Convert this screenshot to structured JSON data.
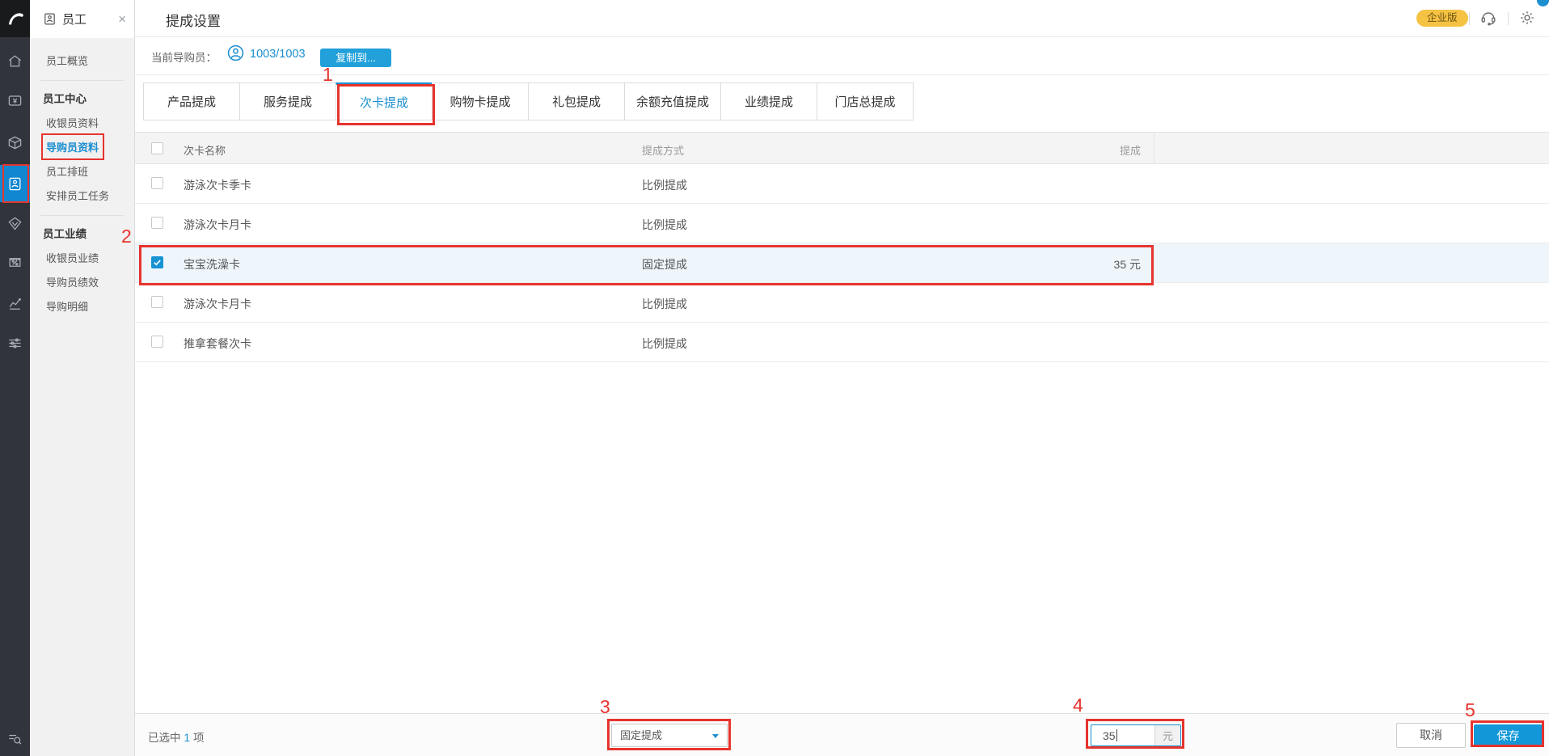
{
  "chrome": {
    "badge": "企业版",
    "close_label": "×",
    "icons": [
      "headset-icon",
      "gear-icon"
    ]
  },
  "rail": {
    "icons": [
      "home",
      "cashier",
      "orders",
      "staff",
      "membership",
      "marketing",
      "statistics",
      "settings-sliders"
    ],
    "active_icon": "staff",
    "bottom_icon": "search-menu"
  },
  "sidebar": {
    "title": "员工",
    "overview": "员工概览",
    "sections": [
      {
        "header": "员工中心",
        "items": [
          "收银员资料",
          "导购员资料",
          "员工排班",
          "安排员工任务"
        ]
      },
      {
        "header": "员工业绩",
        "items": [
          "收银员业绩",
          "导购员绩效",
          "导购明细"
        ]
      }
    ],
    "active_item": "导购员资料"
  },
  "page": {
    "title": "提成设置"
  },
  "toolbar": {
    "label": "当前导购员：",
    "guide_count": "1003/1003",
    "copy_button": "复制到..."
  },
  "tabs": [
    "产品提成",
    "服务提成",
    "次卡提成",
    "购物卡提成",
    "礼包提成",
    "余额充值提成",
    "业绩提成",
    "门店总提成"
  ],
  "active_tab": "次卡提成",
  "table": {
    "columns": {
      "name": "次卡名称",
      "method": "提成方式",
      "commission": "提成"
    },
    "rows": [
      {
        "name": "游泳次卡季卡",
        "method": "比例提成",
        "commission": "",
        "checked": false
      },
      {
        "name": "游泳次卡月卡",
        "method": "比例提成",
        "commission": "",
        "checked": false
      },
      {
        "name": "宝宝洗澡卡",
        "method": "固定提成",
        "commission": "35 元",
        "checked": true
      },
      {
        "name": "游泳次卡月卡",
        "method": "比例提成",
        "commission": "",
        "checked": false
      },
      {
        "name": "推拿套餐次卡",
        "method": "比例提成",
        "commission": "",
        "checked": false
      }
    ]
  },
  "footer": {
    "selected_prefix": "已选中",
    "selected_count": "1",
    "selected_suffix": "项",
    "method_select": "固定提成",
    "amount_value": "35",
    "amount_unit": "元",
    "cancel_button": "取消",
    "save_button": "保存"
  },
  "annotations": {
    "1": "1",
    "2": "2",
    "3": "3",
    "4": "4",
    "5": "5"
  },
  "colors": {
    "accent_blue": "#1b8fd0",
    "button_blue": "#1298d8",
    "copy_button_blue": "#22a0da",
    "rail_bg": "#31353b",
    "rail_active_bg": "#1087d0",
    "annotation_red": "#e6342e",
    "badge_yellow": "#f6c243",
    "selected_row_bg": "#eef6fc",
    "table_header_bg": "#f4f4f4",
    "panel_bg": "#f1f1f1"
  }
}
